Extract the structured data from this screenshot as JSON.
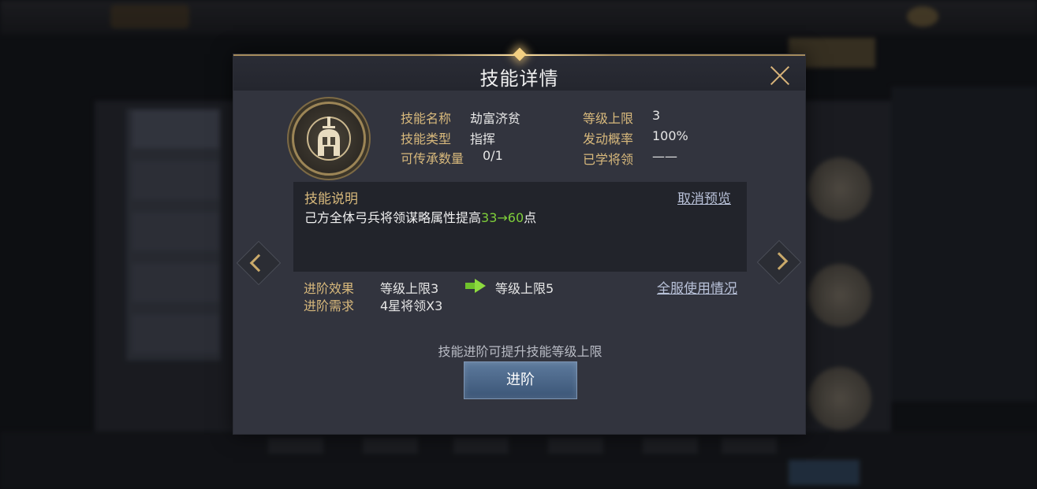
{
  "dialog": {
    "title": "技能详情",
    "close_icon": "close-icon"
  },
  "skill": {
    "icon": "helmet-sword-emblem-icon",
    "name_label": "技能名称",
    "name_value": "劫富济贫",
    "type_label": "技能类型",
    "type_value": "指挥",
    "inherit_label": "可传承数量",
    "inherit_value": "0/1",
    "level_cap_label": "等级上限",
    "level_cap_value": "3",
    "trigger_rate_label": "发动概率",
    "trigger_rate_value": "100%",
    "learned_label": "已学将领",
    "learned_value": "——"
  },
  "description": {
    "title": "技能说明",
    "text_prefix": "己方全体弓兵将领谋略属性提高",
    "value_from": "33",
    "arrow": "→",
    "value_to": "60",
    "text_suffix": "点",
    "cancel_preview": "取消预览"
  },
  "advance": {
    "effect_label": "进阶效果",
    "effect_from": "等级上限3",
    "effect_to": "等级上限5",
    "require_label": "进阶需求",
    "require_value": "4星将领X3",
    "server_usage_link": "全服使用情况",
    "hint": "技能进阶可提升技能等级上限",
    "button_label": "进阶"
  },
  "colors": {
    "accent_gold": "#d8b97c",
    "highlight_green": "#7fcf3a",
    "button_blue": "#4a6688",
    "dialog_bg": "#32343e"
  }
}
